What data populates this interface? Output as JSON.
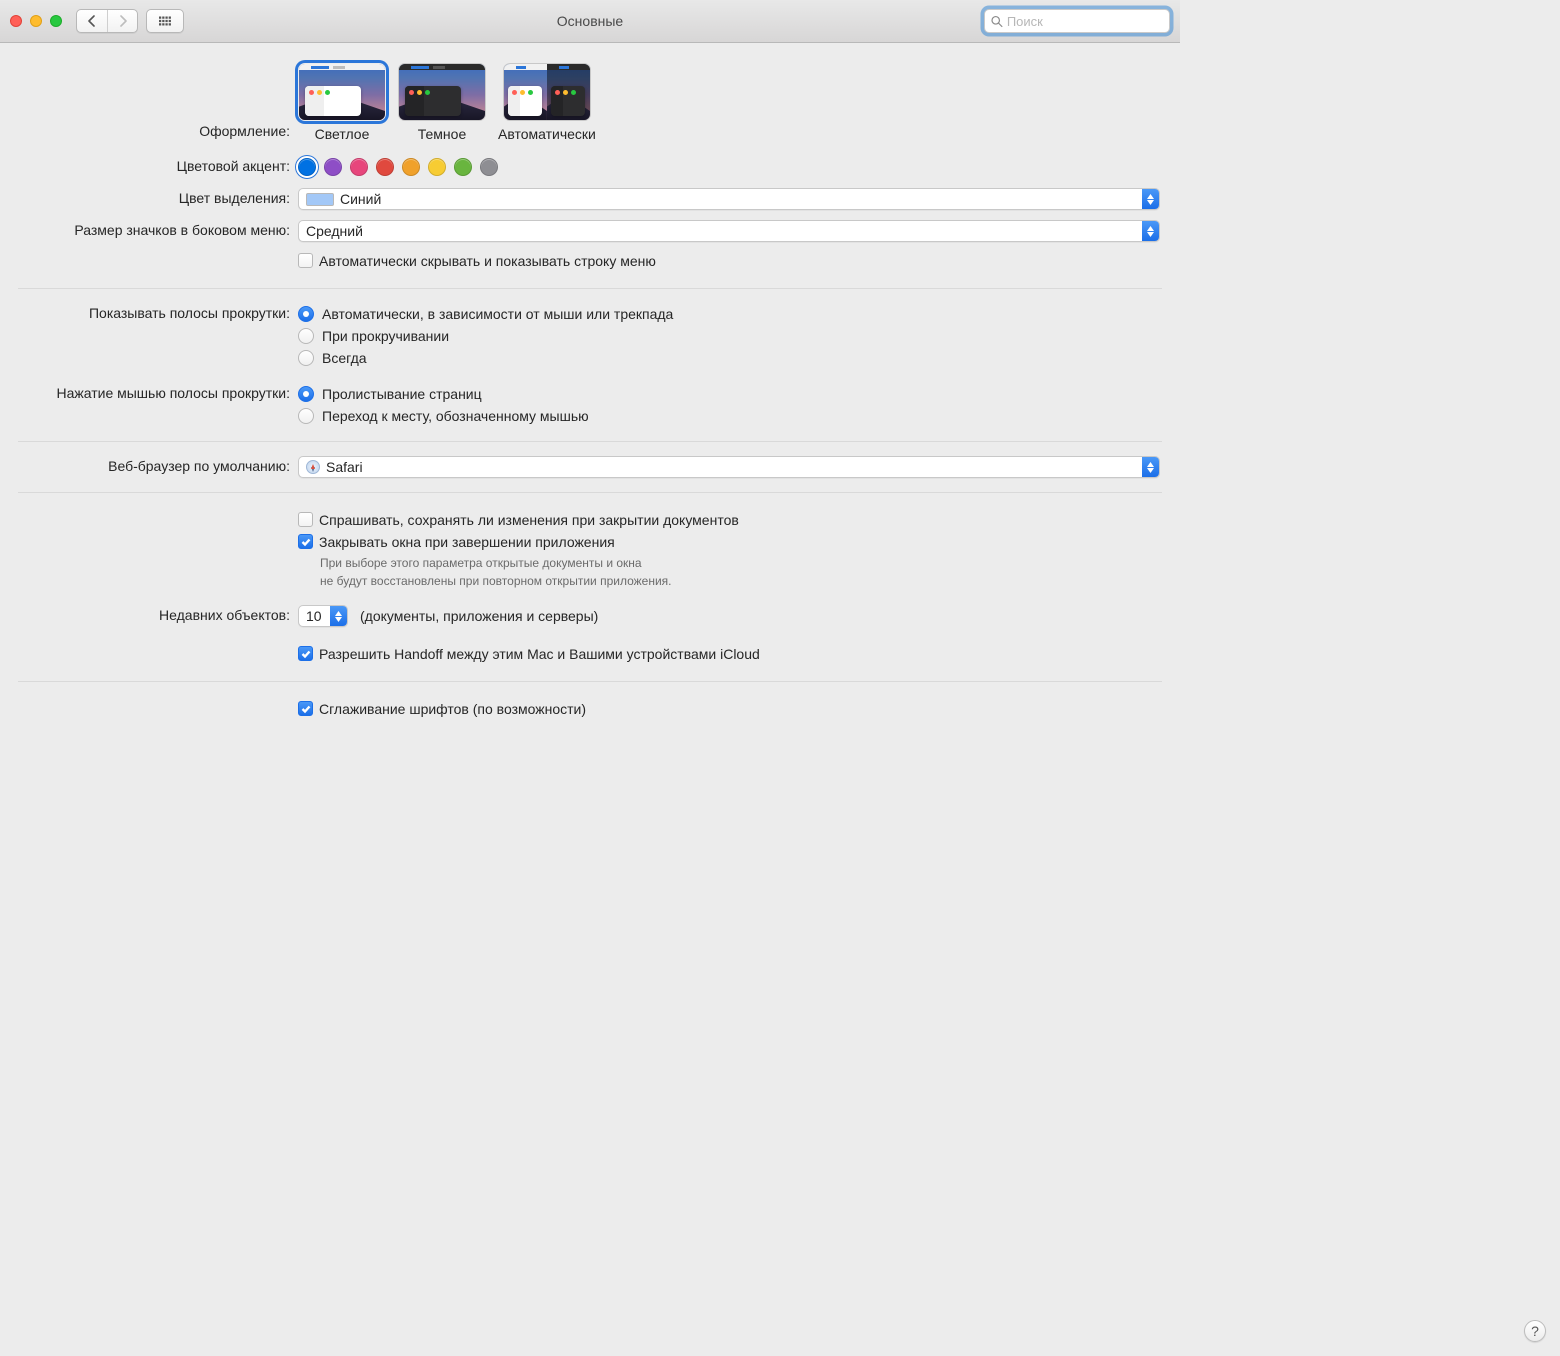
{
  "window": {
    "title": "Основные"
  },
  "search": {
    "placeholder": "Поиск"
  },
  "labels": {
    "appearance": "Оформление:",
    "accent": "Цветовой акцент:",
    "highlight": "Цвет выделения:",
    "sidebar_icon": "Размер значков в боковом меню:",
    "scrollbars": "Показывать полосы прокрутки:",
    "scroll_click": "Нажатие мышью полосы прокрутки:",
    "browser": "Веб-браузер по умолчанию:",
    "recent": "Недавних объектов:",
    "recent_suffix": "(документы, приложения и серверы)"
  },
  "appearance": {
    "options": [
      "Светлое",
      "Темное",
      "Автоматически"
    ],
    "selected": 0
  },
  "accent_colors": [
    "#0071e3",
    "#8e4ec6",
    "#e7467c",
    "#e0493e",
    "#f0a12b",
    "#f7cc33",
    "#69b53f",
    "#8e8e93"
  ],
  "accent_selected": 0,
  "highlight": {
    "value": "Синий"
  },
  "sidebar_icon": {
    "value": "Средний"
  },
  "auto_hide_menubar": {
    "label": "Автоматически скрывать и показывать строку меню",
    "checked": false
  },
  "scrollbars": {
    "options": [
      "Автоматически, в зависимости от мыши или трекпада",
      "При прокручивании",
      "Всегда"
    ],
    "selected": 0
  },
  "scroll_click": {
    "options": [
      "Пролистывание страниц",
      "Переход к месту, обозначенному мышью"
    ],
    "selected": 0
  },
  "browser": {
    "value": "Safari"
  },
  "ask_save": {
    "label": "Спрашивать, сохранять ли изменения при закрытии документов",
    "checked": false
  },
  "close_windows": {
    "label": "Закрывать окна при завершении приложения",
    "checked": true,
    "note1": "При выборе этого параметра открытые документы и окна",
    "note2": "не будут восстановлены при повторном открытии приложения."
  },
  "recent": {
    "value": "10"
  },
  "handoff": {
    "label": "Разрешить Handoff между этим Mac и Вашими устройствами iCloud",
    "checked": true
  },
  "font_smoothing": {
    "label": "Сглаживание шрифтов (по возможности)",
    "checked": true
  }
}
